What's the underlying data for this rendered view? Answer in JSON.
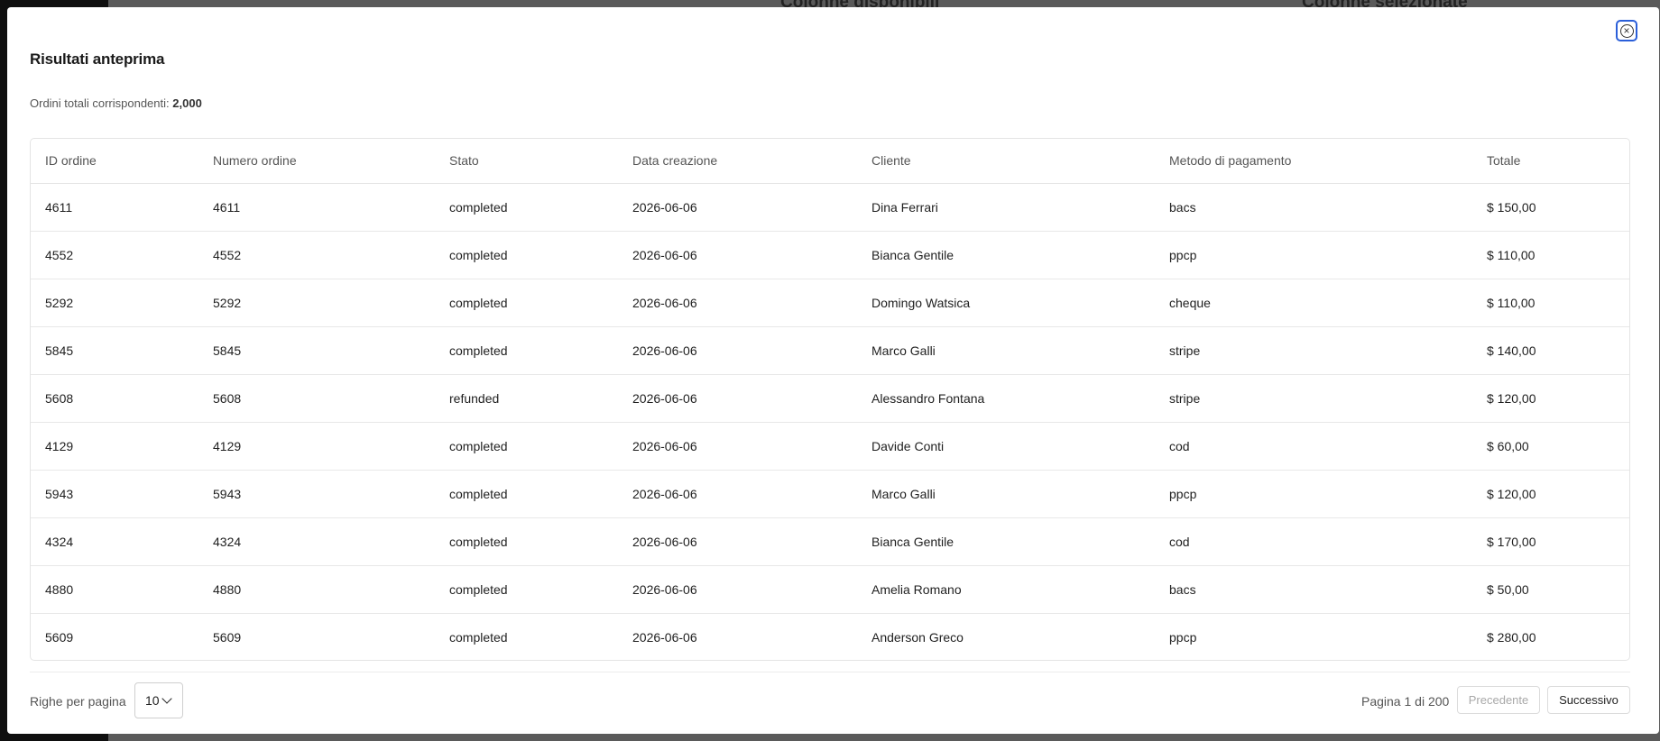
{
  "background": {
    "headings": [
      "Colonne disponibili",
      "Colonne selezionate"
    ]
  },
  "modal": {
    "title": "Risultati anteprima",
    "summary_label": "Ordini totali corrispondenti:",
    "summary_value": "2,000",
    "close_icon": "close-circle-icon"
  },
  "table": {
    "columns": [
      "ID ordine",
      "Numero ordine",
      "Stato",
      "Data creazione",
      "Cliente",
      "Metodo di pagamento",
      "Totale"
    ],
    "rows": [
      [
        "4611",
        "4611",
        "completed",
        "2026-06-06",
        "Dina Ferrari",
        "bacs",
        "$ 150,00"
      ],
      [
        "4552",
        "4552",
        "completed",
        "2026-06-06",
        "Bianca Gentile",
        "ppcp",
        "$ 110,00"
      ],
      [
        "5292",
        "5292",
        "completed",
        "2026-06-06",
        "Domingo Watsica",
        "cheque",
        "$ 110,00"
      ],
      [
        "5845",
        "5845",
        "completed",
        "2026-06-06",
        "Marco Galli",
        "stripe",
        "$ 140,00"
      ],
      [
        "5608",
        "5608",
        "refunded",
        "2026-06-06",
        "Alessandro Fontana",
        "stripe",
        "$ 120,00"
      ],
      [
        "4129",
        "4129",
        "completed",
        "2026-06-06",
        "Davide Conti",
        "cod",
        "$ 60,00"
      ],
      [
        "5943",
        "5943",
        "completed",
        "2026-06-06",
        "Marco Galli",
        "ppcp",
        "$ 120,00"
      ],
      [
        "4324",
        "4324",
        "completed",
        "2026-06-06",
        "Bianca Gentile",
        "cod",
        "$ 170,00"
      ],
      [
        "4880",
        "4880",
        "completed",
        "2026-06-06",
        "Amelia Romano",
        "bacs",
        "$ 50,00"
      ],
      [
        "5609",
        "5609",
        "completed",
        "2026-06-06",
        "Anderson Greco",
        "ppcp",
        "$ 280,00"
      ]
    ]
  },
  "pagination": {
    "rows_label": "Righe per pagina",
    "rows_value": "10",
    "page_info": "Pagina 1 di 200",
    "prev_label": "Precedente",
    "next_label": "Successivo"
  }
}
